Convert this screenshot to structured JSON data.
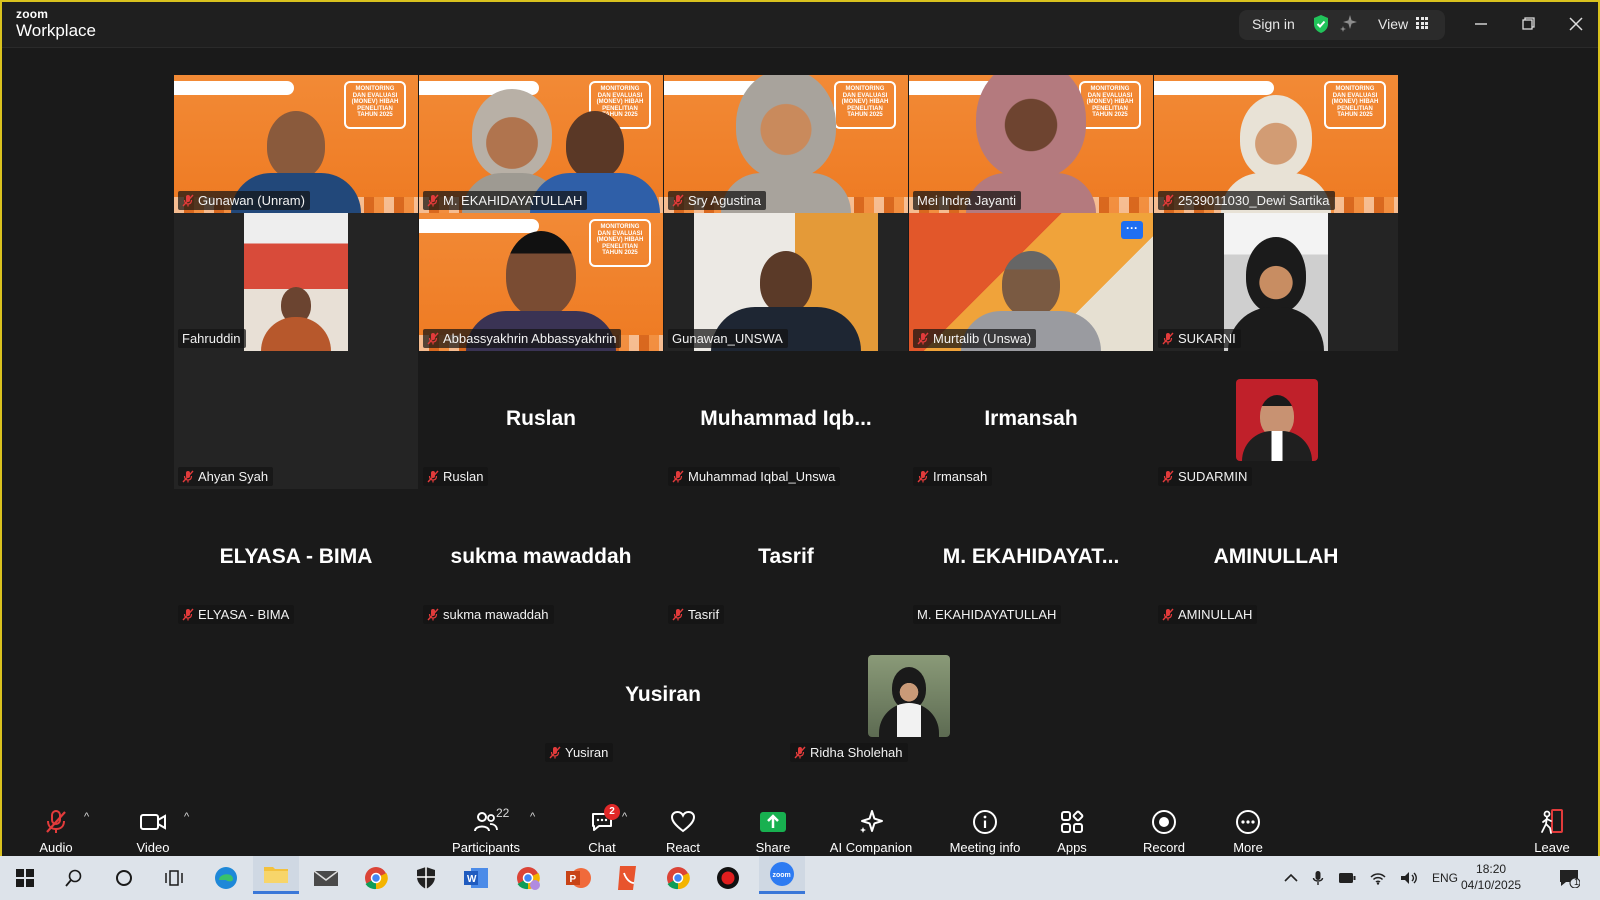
{
  "titlebar": {
    "brand_small": "zoom",
    "brand_large": "Workplace",
    "sign_in": "Sign in",
    "view": "View"
  },
  "tiles": {
    "gunawan_unram": "Gunawan (Unram)",
    "ekahidayatullah_video": "M. EKAHIDAYATULLAH",
    "sry": "Sry Agustina",
    "mei": "Mei Indra Jayanti",
    "dewi": "2539011030_Dewi Sartika",
    "fahruddin": "Fahruddin",
    "abbas": "Abbassyakhrin Abbassyakhrin",
    "gunawan_unswa": "Gunawan_UNSWA",
    "murtalib": "Murtalib (Unswa)",
    "sukarni": "SUKARNI",
    "ahyan": "Ahyan Syah",
    "ruslan_big": "Ruslan",
    "ruslan": "Ruslan",
    "iqbal_big": "Muhammad  Iqb...",
    "iqbal": "Muhammad Iqbal_Unswa",
    "irmansah_big": "Irmansah",
    "irmansah": "Irmansah",
    "sudarmin": "SUDARMIN",
    "elyasa_big": "ELYASA - BIMA",
    "elyasa": "ELYASA - BIMA",
    "sukma_big": "sukma mawaddah",
    "sukma": "sukma mawaddah",
    "tasrif_big": "Tasrif",
    "tasrif": "Tasrif",
    "eka_big": "M.  EKAHIDAYAT...",
    "eka": "M. EKAHIDAYATULLAH",
    "aminullah_big": "AMINULLAH",
    "aminullah": "AMINULLAH",
    "yusiran_big": "Yusiran",
    "yusiran": "Yusiran",
    "ridha": "Ridha Sholehah",
    "banner_text": "MONITORING DAN EVALUASI (MONEV) HIBAH PENELITIAN TAHUN 2025",
    "more_menu": "···"
  },
  "toolbar": {
    "audio": "Audio",
    "video": "Video",
    "participants": "Participants",
    "participants_count": "22",
    "chat": "Chat",
    "chat_badge": "2",
    "react": "React",
    "share": "Share",
    "ai": "AI Companion",
    "info": "Meeting info",
    "apps": "Apps",
    "record": "Record",
    "more": "More",
    "leave": "Leave"
  },
  "taskbar": {
    "lang": "ENG",
    "time": "18:20",
    "date": "04/10/2025",
    "notif_count": "1"
  },
  "colors": {
    "accent_green": "#20c562",
    "orange_bg": "#f07f2a",
    "share_green": "#18b050",
    "badge_red": "#e02828"
  }
}
